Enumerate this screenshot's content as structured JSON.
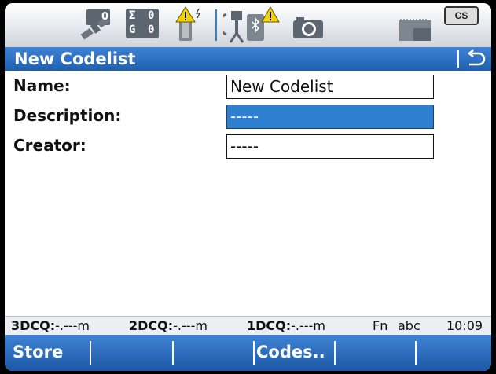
{
  "status": {
    "satellites": "0",
    "counter_sigma": "0",
    "counter_g": "0",
    "cs_badge": "CS",
    "icons": [
      "satellite-icon",
      "sigma-counter-icon",
      "battery-warning-icon",
      "tripod-bluetooth-warning-icon",
      "camera-icon",
      "memory-card-icon"
    ]
  },
  "title": {
    "text": "New Codelist",
    "back_icon": "back-arrow-icon"
  },
  "form": {
    "fields": [
      {
        "label": "Name:",
        "value": "New Codelist"
      },
      {
        "label": "Description:",
        "value": "-----"
      },
      {
        "label": "Creator:",
        "value": "-----"
      }
    ]
  },
  "info": {
    "q3d_label": "3DCQ:",
    "q3d_value": "-.---m",
    "q2d_label": "2DCQ:",
    "q2d_value": "-.---m",
    "q1d_label": "1DCQ:",
    "q1d_value": "-.---m",
    "fn": "Fn",
    "input_mode": "abc",
    "time": "10:09"
  },
  "softkeys": {
    "f1": "Store",
    "f2": "",
    "f3": "",
    "f4": "Codes..",
    "f5": "",
    "f6": ""
  },
  "colors": {
    "accent": "#2f7fd1",
    "titlebar": "#1f5fae",
    "selected_field": "#2f7fd1"
  }
}
